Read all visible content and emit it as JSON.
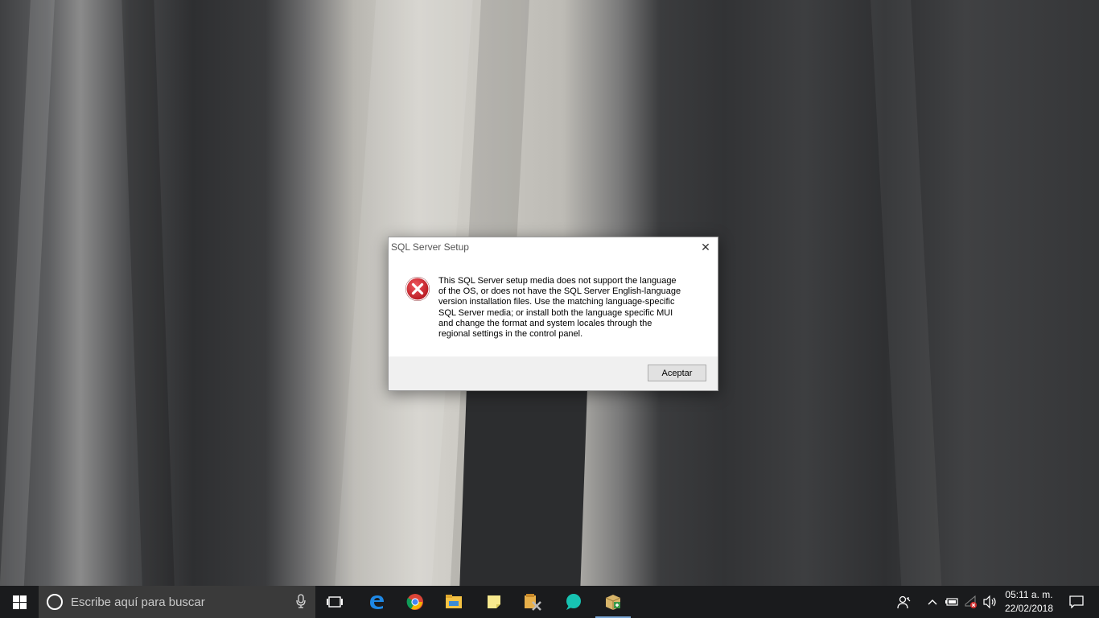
{
  "dialog": {
    "title": "SQL Server Setup",
    "close_glyph": "✕",
    "icon": "error-icon",
    "message": "This SQL Server setup media does not support the language\nof the OS, or does not have the SQL Server English-language\nversion installation files.  Use the matching language-specific\nSQL Server media; or install  both the language specific MUI\nand change the format and system locales through the\nregional settings in the control panel.",
    "ok_label": "Aceptar"
  },
  "taskbar": {
    "search_placeholder": "Escribe aquí para buscar",
    "apps": [
      "task-view-icon",
      "edge-icon",
      "chrome-icon",
      "file-explorer-icon",
      "sticky-notes-icon",
      "installer-icon",
      "teal-app-icon",
      "package-installer-icon"
    ],
    "tray_icons": [
      "people-icon",
      "chevron-up-icon",
      "battery-icon",
      "network-error-icon",
      "volume-icon",
      "notifications-icon"
    ],
    "time": "05:11 a. m.",
    "date": "22/02/2018"
  },
  "colors": {
    "taskbar_bg": "#1a1b1d",
    "search_bg": "#3a3a3a",
    "error_red": "#c8232c",
    "dialog_footer": "#f0f0f0"
  }
}
